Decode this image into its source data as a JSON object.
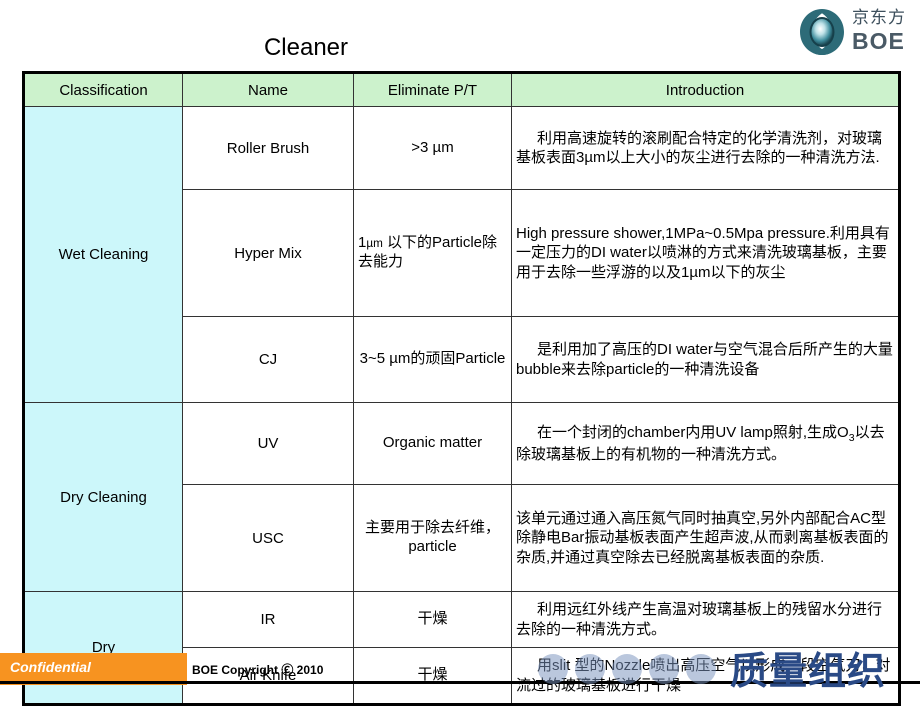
{
  "slide": {
    "title": "Cleaner"
  },
  "logo": {
    "mark_name": "boe-eye-mark",
    "chinese": "京东方",
    "english": "BOE",
    "mark_color": "#2d6b78"
  },
  "table": {
    "headers": [
      "Classification",
      "Name",
      "Eliminate P/T",
      "Introduction"
    ],
    "groups": [
      {
        "classification": "Wet Cleaning",
        "rows": [
          {
            "name": "Roller Brush",
            "eliminate": ">3 µm",
            "eliminate_align": "center",
            "introduction": "利用高速旋转的滚刷配合特定的化学清洗剂，对玻璃基板表面3µm以上大小的灰尘进行去除的一种清洗方法."
          },
          {
            "name": "Hyper Mix",
            "eliminate": "1µm 以下的Particle除去能力",
            "eliminate_align": "left",
            "introduction": "High pressure shower,1MPa~0.5Mpa pressure.利用具有一定压力的DI water以喷淋的方式来清洗玻璃基板，主要用于去除一些浮游的以及1µm以下的灰尘"
          },
          {
            "name": "CJ",
            "eliminate": "3~5 µm的顽固Particle",
            "eliminate_align": "center",
            "introduction": "是利用加了高压的DI water与空气混合后所产生的大量bubble来去除particle的一种清洗设备"
          }
        ]
      },
      {
        "classification": "Dry Cleaning",
        "rows": [
          {
            "name": "UV",
            "eliminate": "Organic matter",
            "eliminate_align": "center",
            "introduction": "在一个封闭的chamber内用UV lamp照射,生成O3以去除玻璃基板上的有机物的一种清洗方式。"
          },
          {
            "name": "USC",
            "eliminate": "主要用于除去纤维，particle",
            "eliminate_align": "center",
            "introduction": "该单元通过通入高压氮气同时抽真空,另外内部配合AC型除静电Bar振动基板表面产生超声波,从而剥离基板表面的杂质,并通过真空除去已经脱离基板表面的杂质."
          }
        ]
      },
      {
        "classification": "Dry",
        "rows": [
          {
            "name": "IR",
            "eliminate": "干燥",
            "eliminate_align": "center",
            "introduction": "利用远红外线产生高温对玻璃基板上的残留水分进行去除的一种清洗方式。"
          },
          {
            "name": "Air Knife",
            "eliminate": "干燥",
            "eliminate_align": "center",
            "introduction": "用slit 型的Nozzle喷出高压空气以形成一段空气刀，对流过的玻璃基板进行干燥"
          }
        ]
      }
    ]
  },
  "footer": {
    "confidential": "Confidential",
    "copyright": "BOE  Copyright Ⓒ 2010",
    "orange_color": "#f79320"
  },
  "watermark": {
    "text": "质量组织",
    "dot_count": 5,
    "color": "#2a4a86"
  },
  "colors": {
    "header_green": "#ccf2cc",
    "classification_cyan": "#ccf7fa",
    "border": "#333333"
  }
}
